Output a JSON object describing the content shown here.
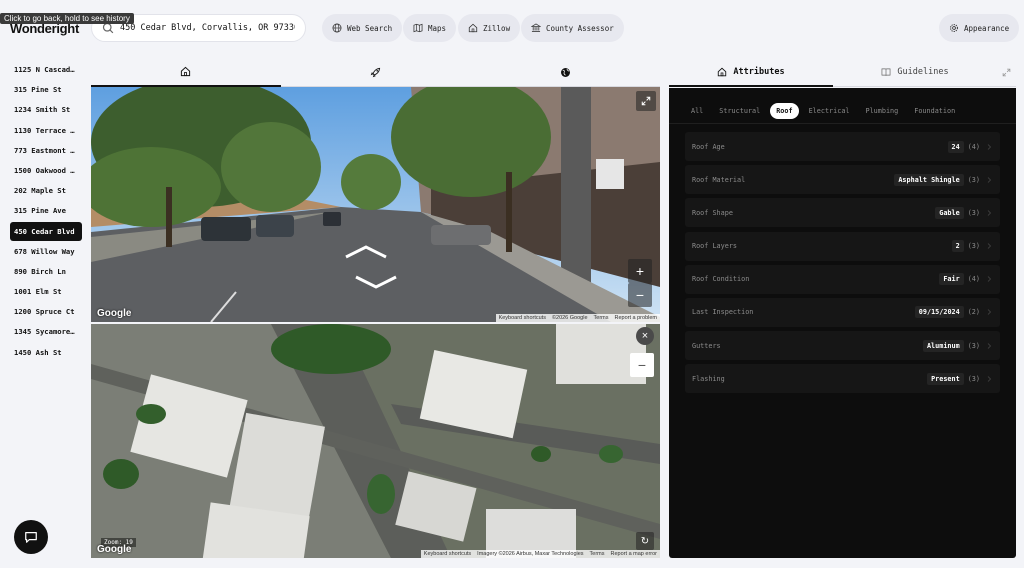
{
  "tooltip": "Click to go back, hold to see history",
  "app": {
    "logo": "Wonderight"
  },
  "search": {
    "value": "450 Cedar Blvd, Corvallis, OR 97330"
  },
  "toolbar": {
    "web_search": "Web Search",
    "maps": "Maps",
    "zillow": "Zillow",
    "county_assessor": "County Assessor",
    "appearance": "Appearance"
  },
  "sidebar": {
    "items": [
      {
        "label": "1125 N Cascad…"
      },
      {
        "label": "315 Pine St"
      },
      {
        "label": "1234 Smith St"
      },
      {
        "label": "1130 Terrace …"
      },
      {
        "label": "773 Eastmont …"
      },
      {
        "label": "1500 Oakwood …"
      },
      {
        "label": "202 Maple St"
      },
      {
        "label": "315 Pine Ave"
      },
      {
        "label": "450 Cedar Blvd"
      },
      {
        "label": "678 Willow Way"
      },
      {
        "label": "890 Birch Ln"
      },
      {
        "label": "1001 Elm St"
      },
      {
        "label": "1200 Spruce Ct"
      },
      {
        "label": "1345 Sycamore…"
      },
      {
        "label": "1450 Ash St"
      }
    ],
    "active_index": 8
  },
  "street_view": {
    "google": "Google",
    "attrib": [
      "Keyboard shortcuts",
      "©2026 Google",
      "Terms",
      "Report a problem"
    ]
  },
  "aerial_view": {
    "zoom": "Zoom: 19",
    "google": "Google",
    "attrib": [
      "Keyboard shortcuts",
      "Imagery ©2026 Airbus, Maxar Technologies",
      "Terms",
      "Report a map error"
    ]
  },
  "panel": {
    "tabs": {
      "attributes": "Attributes",
      "guidelines": "Guidelines"
    },
    "categories": [
      {
        "label": "All"
      },
      {
        "label": "Structural"
      },
      {
        "label": "Roof"
      },
      {
        "label": "Electrical"
      },
      {
        "label": "Plumbing"
      },
      {
        "label": "Foundation"
      }
    ],
    "active_category": 2,
    "rows": [
      {
        "label": "Roof Age",
        "value": "24",
        "count": "(4)"
      },
      {
        "label": "Roof Material",
        "value": "Asphalt Shingle",
        "count": "(3)"
      },
      {
        "label": "Roof Shape",
        "value": "Gable",
        "count": "(3)"
      },
      {
        "label": "Roof Layers",
        "value": "2",
        "count": "(3)"
      },
      {
        "label": "Roof Condition",
        "value": "Fair",
        "count": "(4)"
      },
      {
        "label": "Last Inspection",
        "value": "09/15/2024",
        "count": "(2)"
      },
      {
        "label": "Gutters",
        "value": "Aluminum",
        "count": "(3)"
      },
      {
        "label": "Flashing",
        "value": "Present",
        "count": "(3)"
      }
    ]
  },
  "colors": {
    "accent": "#111111",
    "panel_bg": "#0d0d0d",
    "row_bg": "#161616"
  }
}
